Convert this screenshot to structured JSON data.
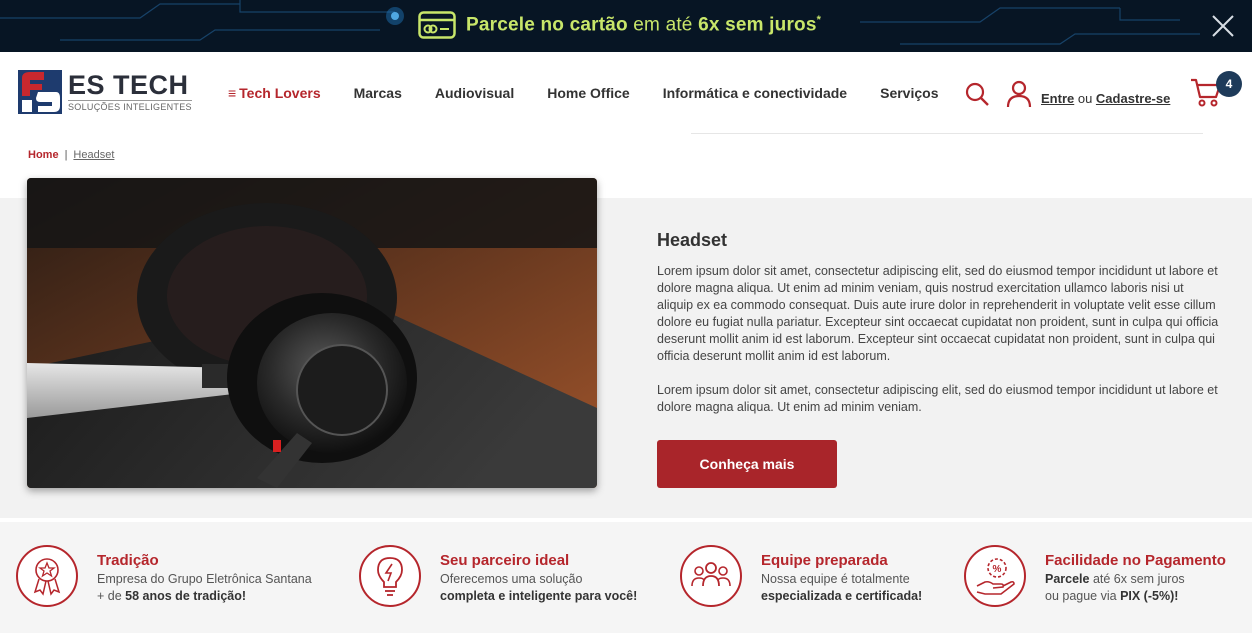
{
  "promo": {
    "text_bold1": "Parcele no cartão",
    "text_thin": " em até ",
    "text_bold2": "6x sem juros",
    "asterisk": "*",
    "accent_color": "#c8e66a"
  },
  "header": {
    "logo_name": "ES TECH",
    "logo_sub": "SOLUÇÕES INTELIGENTES",
    "nav": [
      "Tech Lovers",
      "Marcas",
      "Audiovisual",
      "Home Office",
      "Informática e conectividade",
      "Serviços"
    ],
    "login_link": "Entre",
    "login_or": " ou ",
    "signup_link": "Cadastre-se",
    "cart_count": "4",
    "brand_color": "#b5262c"
  },
  "breadcrumb": {
    "home": "Home",
    "separator": "|",
    "current": "Headset"
  },
  "main": {
    "title": "Headset",
    "paragraph1": "Lorem ipsum dolor sit amet, consectetur adipiscing elit, sed do eiusmod tempor incididunt ut labore et dolore magna aliqua. Ut enim ad minim veniam, quis nostrud exercitation ullamco laboris nisi ut aliquip ex ea commodo consequat. Duis aute irure dolor in reprehenderit in voluptate velit esse cillum dolore eu fugiat nulla pariatur. Excepteur sint occaecat cupidatat non proident, sunt in culpa qui officia deserunt mollit anim id est laborum. Excepteur sint occaecat cupidatat non proident, sunt in culpa qui officia deserunt mollit anim id est laborum.",
    "paragraph2": "Lorem ipsum dolor sit amet, consectetur adipiscing elit, sed do eiusmod tempor incididunt ut labore et dolore magna aliqua. Ut enim ad minim veniam.",
    "cta": "Conheça mais"
  },
  "features": [
    {
      "icon": "award-badge-icon",
      "title": "Tradição",
      "line1": "Empresa do Grupo Eletrônica Santana",
      "line2_pre": "+ de ",
      "line2_bold": "58 anos de tradição!"
    },
    {
      "icon": "lightbulb-icon",
      "title": "Seu parceiro ideal",
      "line1": "Oferecemos uma solução",
      "line2_pre": "",
      "line2_bold": "completa e inteligente para você!"
    },
    {
      "icon": "team-icon",
      "title": "Equipe preparada",
      "line1": "Nossa equipe é totalmente",
      "line2_pre": "",
      "line2_bold": "especializada e certificada!"
    },
    {
      "icon": "payment-hand-icon",
      "title": "Facilidade no Pagamento",
      "line1_bold": "Parcele",
      "line1": " até 6x sem juros",
      "line2_pre": "ou pague via ",
      "line2_bold": "PIX (-5%)!"
    }
  ]
}
